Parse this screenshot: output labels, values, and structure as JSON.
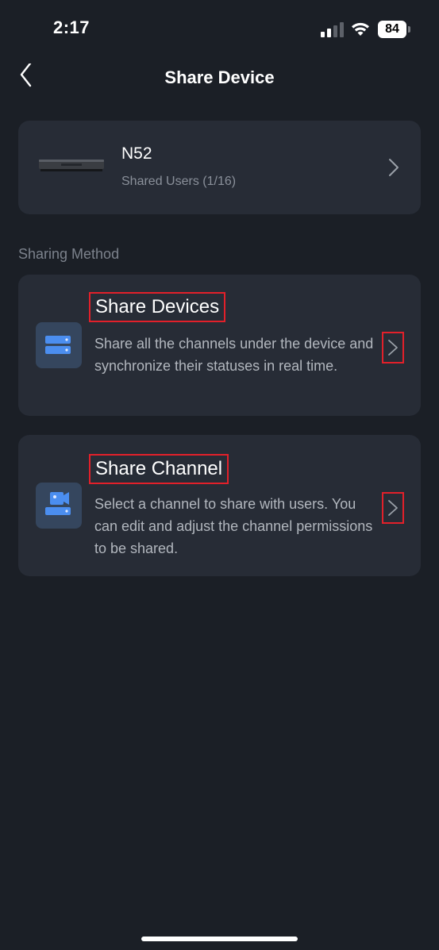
{
  "status_bar": {
    "time": "2:17",
    "battery": "84",
    "signal_icon": "cellular-signal-icon",
    "wifi_icon": "wifi-icon",
    "battery_icon": "battery-icon"
  },
  "nav": {
    "title": "Share Device",
    "back_icon": "chevron-left-icon"
  },
  "device": {
    "name": "N52",
    "shared_users": "Shared Users (1/16)",
    "image": "nvr-device-image"
  },
  "section": {
    "label": "Sharing Method"
  },
  "methods": [
    {
      "title": "Share Devices",
      "description": "Share all the channels under the device and synchronize their statuses in real time.",
      "icon": "server-stack-icon"
    },
    {
      "title": "Share Channel",
      "description": "Select a channel to share with users. You can edit and adjust the channel permissions to be shared.",
      "icon": "camera-channel-icon"
    }
  ],
  "colors": {
    "background": "#1b1f26",
    "card": "#272c36",
    "highlight_border": "#e2202a",
    "icon_blue": "#4b8ef0",
    "secondary_text": "#8a909a"
  }
}
